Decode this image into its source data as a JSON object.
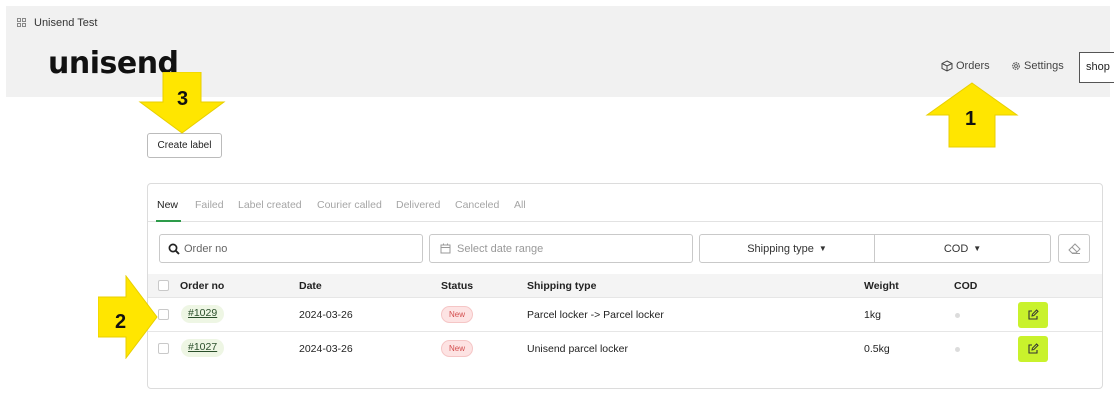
{
  "window": {
    "title": "Unisend Test",
    "icon": "app-grid-icon"
  },
  "header": {
    "logo": "unisend",
    "nav": [
      {
        "label": "Orders",
        "icon": "box-icon"
      },
      {
        "label": "Settings",
        "icon": "gear-icon"
      }
    ],
    "shop_label": "shop"
  },
  "toolbar": {
    "create_label": "Create label"
  },
  "tabs": [
    "New",
    "Failed",
    "Label created",
    "Courier called",
    "Delivered",
    "Canceled",
    "All"
  ],
  "active_tab": "New",
  "filters": {
    "order_no_placeholder": "Order no",
    "date_placeholder": "Select date range",
    "shipping_type": "Shipping type",
    "cod": "COD",
    "clear_icon": "eraser-icon"
  },
  "table": {
    "columns": [
      "Order no",
      "Date",
      "Status",
      "Shipping type",
      "Weight",
      "COD"
    ],
    "rows": [
      {
        "order_no": "#1029",
        "date": "2024-03-26",
        "status": "New",
        "shipping_type": "Parcel locker -> Parcel locker",
        "weight": "1kg"
      },
      {
        "order_no": "#1027",
        "date": "2024-03-26",
        "status": "New",
        "shipping_type": "Unisend parcel locker",
        "weight": "0.5kg"
      }
    ]
  },
  "annotations": [
    "1",
    "2",
    "3"
  ],
  "colors": {
    "accent": "#c9f22c",
    "annotation": "#ffe600",
    "active_tab": "#2d9b4a",
    "status_badge": "#d34d4d"
  }
}
